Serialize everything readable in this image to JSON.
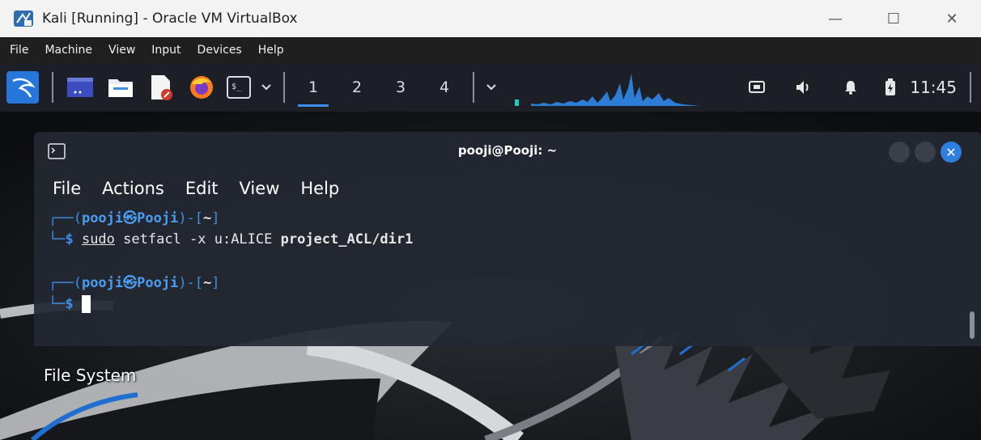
{
  "host_window": {
    "title": "Kali [Running] - Oracle VM VirtualBox",
    "controls": {
      "minimize": "—",
      "maximize": "☐",
      "close": "✕"
    }
  },
  "host_menu": [
    "File",
    "Machine",
    "View",
    "Input",
    "Devices",
    "Help"
  ],
  "kali_panel": {
    "workspaces": [
      "1",
      "2",
      "3",
      "4"
    ],
    "active_workspace": "1",
    "clock": "11:45",
    "icons": [
      "kali-menu-icon",
      "desktop-icon",
      "file-manager-icon",
      "text-editor-icon",
      "firefox-icon",
      "terminal-icon",
      "network-icon",
      "volume-icon",
      "notifications-icon",
      "battery-icon"
    ]
  },
  "terminal": {
    "title": "pooji@Pooji: ~",
    "menu": [
      "File",
      "Actions",
      "Edit",
      "View",
      "Help"
    ],
    "lines": [
      {
        "prefix": "┌──(",
        "user": "pooji㉿Pooji",
        "suffix": ")-[",
        "dir": "~",
        "end": "]"
      },
      {
        "prompt": "└─$ ",
        "sudo": "sudo",
        "cmd": " setfacl -x u:ALICE ",
        "arg": "project_ACL/dir1"
      },
      {
        "prefix": "┌──(",
        "user": "pooji㉿Pooji",
        "suffix": ")-[",
        "dir": "~",
        "end": "]"
      },
      {
        "prompt": "└─$ "
      }
    ]
  },
  "desktop": {
    "label": "File System"
  }
}
